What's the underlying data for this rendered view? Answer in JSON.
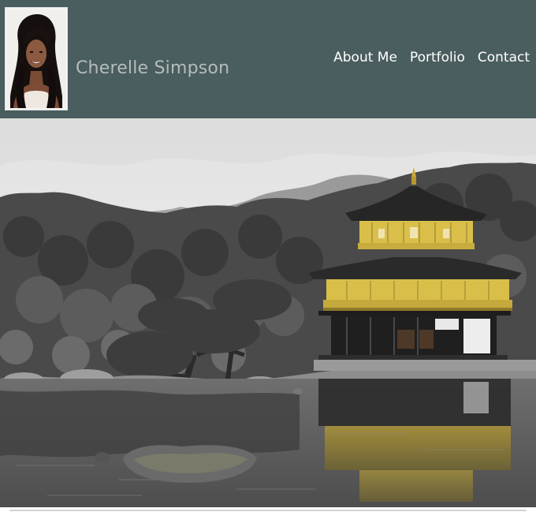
{
  "header": {
    "site_title": "Cherelle Simpson",
    "background_color": "#4a5d5f"
  },
  "nav": {
    "items": [
      {
        "label": "About Me"
      },
      {
        "label": "Portfolio"
      },
      {
        "label": "Contact"
      }
    ]
  },
  "colors": {
    "header_bg": "#4a5d5f",
    "title_text": "#b5bcbc",
    "nav_text": "#ffffff",
    "pagoda_gold": "#d9bf4a"
  },
  "hero": {
    "icon": "golden-pavilion-photo"
  },
  "avatar": {
    "icon": "portrait-photo"
  }
}
